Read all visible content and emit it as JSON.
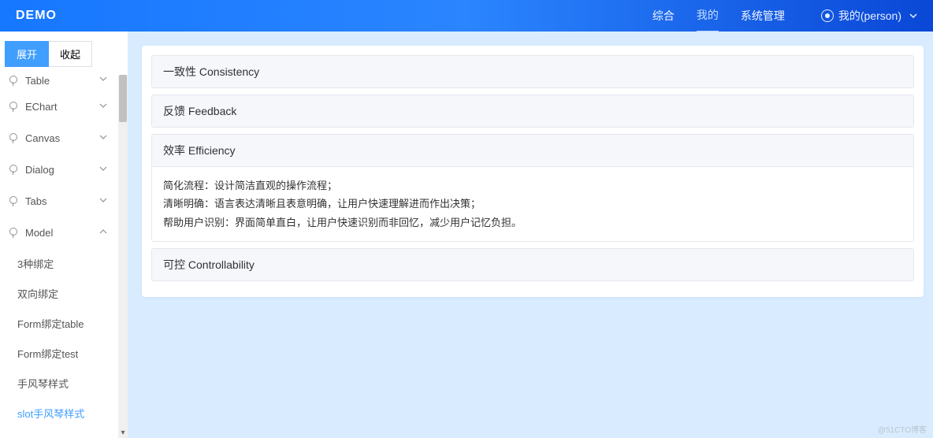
{
  "header": {
    "logo": "DEMO",
    "nav": {
      "zonghe": "综合",
      "wode": "我的",
      "system": "系统管理"
    },
    "user": {
      "label": "我的(person)"
    }
  },
  "toolbar": {
    "expand": "展开",
    "collapse": "收起"
  },
  "sidebar": {
    "items": [
      {
        "label": "Table",
        "expanded": false,
        "partial": true
      },
      {
        "label": "EChart",
        "expanded": false
      },
      {
        "label": "Canvas",
        "expanded": false
      },
      {
        "label": "Dialog",
        "expanded": false
      },
      {
        "label": "Tabs",
        "expanded": false
      },
      {
        "label": "Model",
        "expanded": true
      }
    ],
    "model_children": [
      {
        "label": "3种绑定",
        "active": false
      },
      {
        "label": "双向绑定",
        "active": false
      },
      {
        "label": "Form绑定table",
        "active": false
      },
      {
        "label": "Form绑定test",
        "active": false
      },
      {
        "label": "手风琴样式",
        "active": false
      },
      {
        "label": "slot手风琴样式",
        "active": true
      }
    ]
  },
  "accordion": {
    "consistency": {
      "title": "一致性 Consistency"
    },
    "feedback": {
      "title": "反馈 Feedback"
    },
    "efficiency": {
      "title": "效率 Efficiency",
      "line1": "简化流程：设计简洁直观的操作流程；",
      "line2": "清晰明确：语言表达清晰且表意明确，让用户快速理解进而作出决策；",
      "line3": "帮助用户识别：界面简单直白，让用户快速识别而非回忆，减少用户记忆负担。"
    },
    "controllability": {
      "title": "可控 Controllability"
    }
  },
  "watermark": "@51CTO博客"
}
